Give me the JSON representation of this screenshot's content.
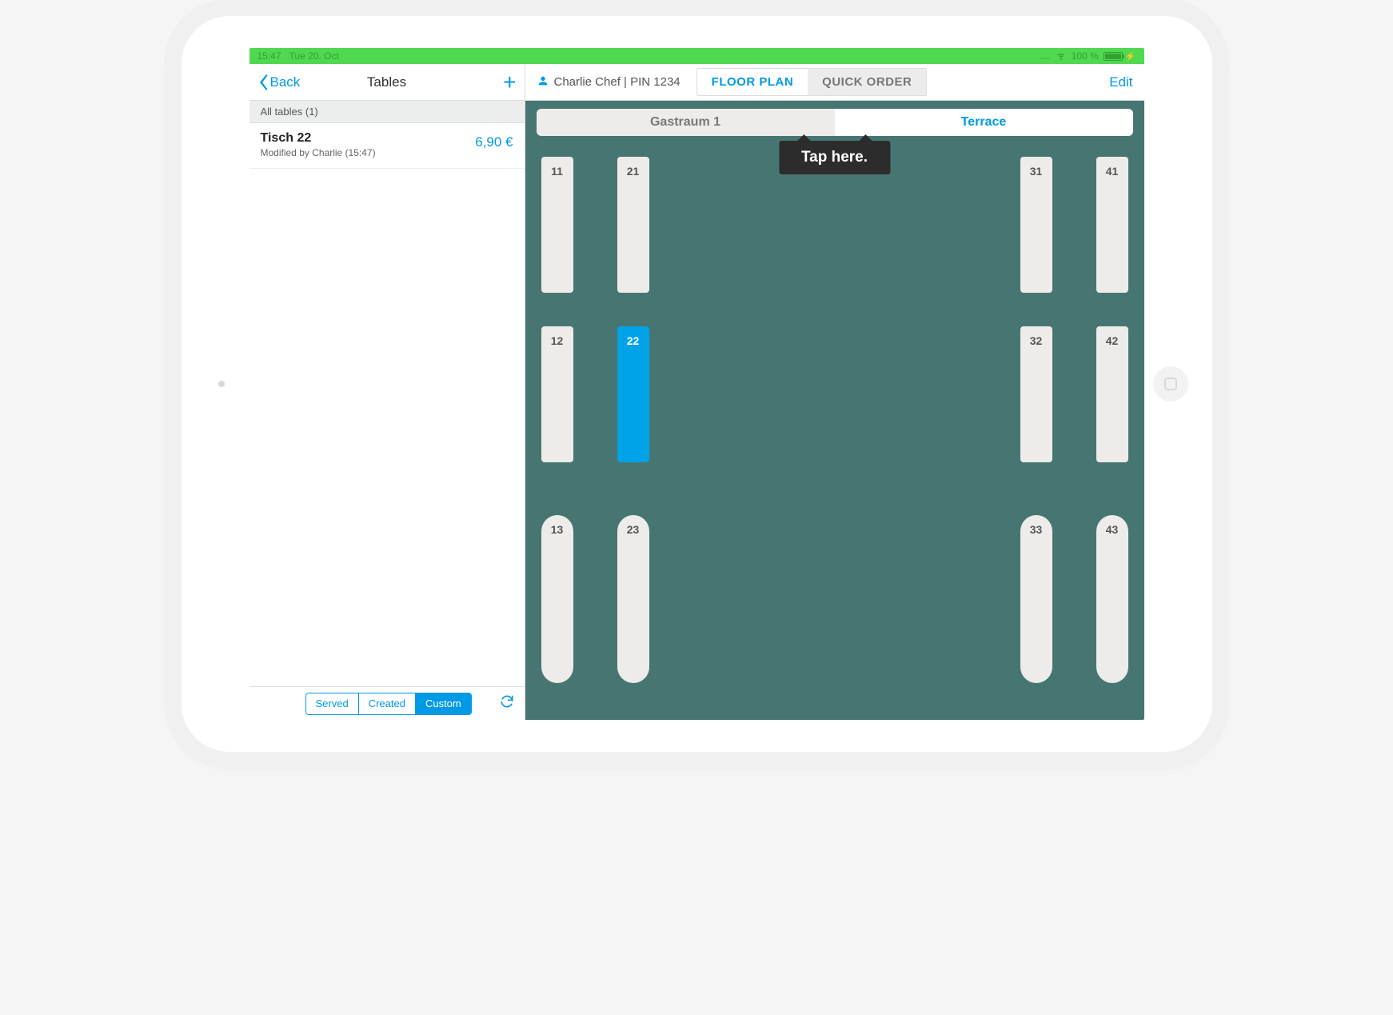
{
  "status": {
    "time": "15:47",
    "date": "Tue 20. Oct",
    "battery_pct": "100 %"
  },
  "sidebar": {
    "back_label": "Back",
    "title": "Tables",
    "all_tables_label": "All tables (1)",
    "item": {
      "name": "Tisch 22",
      "modified": "Modified by Charlie (15:47)",
      "price": "6,90 €"
    },
    "filters": {
      "served": "Served",
      "created": "Created",
      "custom": "Custom"
    }
  },
  "header": {
    "user": "Charlie Chef | PIN 1234",
    "tab_floor": "FLOOR PLAN",
    "tab_quick": "QUICK ORDER",
    "edit": "Edit"
  },
  "rooms": {
    "room1": "Gastraum 1",
    "room2": "Terrace"
  },
  "tooltip": "Tap here.",
  "tables": {
    "t11": "11",
    "t21": "21",
    "t31": "31",
    "t41": "41",
    "t12": "12",
    "t22": "22",
    "t32": "32",
    "t42": "42",
    "t13": "13",
    "t23": "23",
    "t33": "33",
    "t43": "43"
  }
}
